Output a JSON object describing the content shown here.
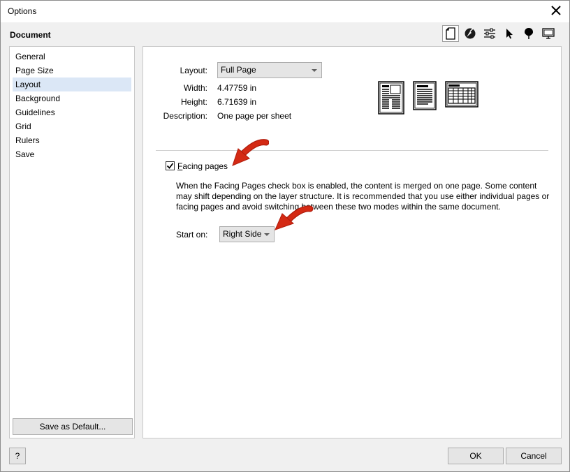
{
  "window": {
    "title": "Options"
  },
  "section_title": "Document",
  "toolbar": {
    "icons": [
      "document-page-icon",
      "color-icon",
      "settings-sliders-icon",
      "pointer-icon",
      "marker-icon",
      "display-icon"
    ],
    "active_index": 0
  },
  "sidebar": {
    "items": [
      {
        "label": "General"
      },
      {
        "label": "Page Size"
      },
      {
        "label": "Layout"
      },
      {
        "label": "Background"
      },
      {
        "label": "Guidelines"
      },
      {
        "label": "Grid"
      },
      {
        "label": "Rulers"
      },
      {
        "label": "Save"
      }
    ],
    "selected_index": 2,
    "save_default_label": "Save as Default..."
  },
  "layout": {
    "layout_label": "Layout:",
    "layout_value": "Full Page",
    "width_label": "Width:",
    "width_value": "4.47759 in",
    "height_label": "Height:",
    "height_value": "6.71639 in",
    "description_label": "Description:",
    "description_value": "One page per sheet"
  },
  "facing": {
    "checked": true,
    "label_accel": "F",
    "label_rest": "acing pages",
    "description": "When the Facing Pages check box is enabled, the content is merged on one page. Some content may shift depending on the layer structure. It is recommended that you use either individual pages or facing pages and avoid switching between these two modes within the same document.",
    "start_on_label": "Start on:",
    "start_on_value": "Right Side"
  },
  "buttons": {
    "help": "?",
    "ok": "OK",
    "cancel": "Cancel"
  },
  "colors": {
    "annotation_arrow": "#d42a14",
    "selection": "#dbe7f6"
  }
}
